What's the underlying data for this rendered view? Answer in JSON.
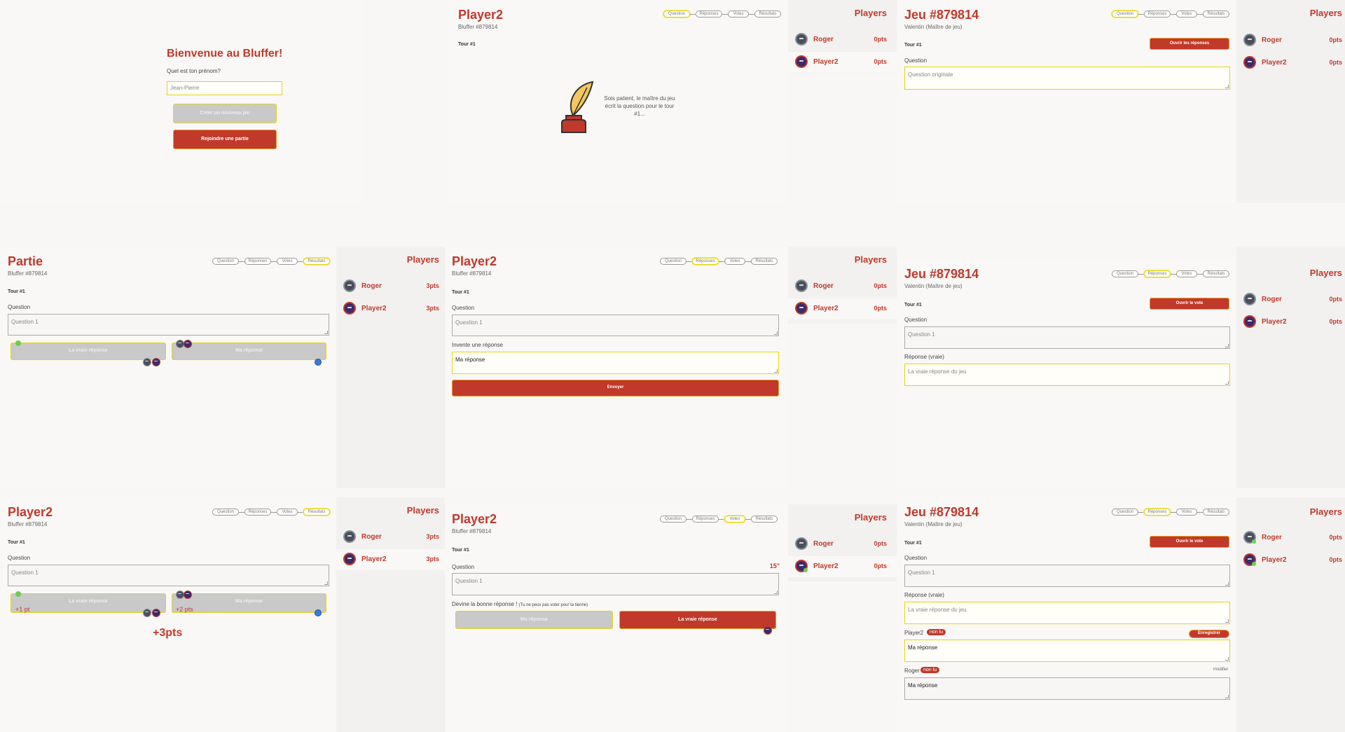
{
  "steps": [
    "Question",
    "Réponses",
    "Votes",
    "Résultats"
  ],
  "players_title": "Players",
  "welcome": {
    "title": "Bienvenue au Bluffer!",
    "prompt": "Quel est ton prénom?",
    "input_placeholder": "Jean-Pierre",
    "create_label": "Créer un nouveau jeu",
    "join_label": "Rejoindre une partie"
  },
  "p2_wait": {
    "title": "Player2",
    "subtitle": "Bluffer #879814",
    "tour": "Tour #1",
    "message": "Sois patient, le maître du jeu écrit la question pour le tour #1..."
  },
  "side_1": {
    "players": [
      {
        "name": "Roger",
        "pts": "0pts"
      },
      {
        "name": "Player2",
        "pts": "0pts"
      }
    ]
  },
  "master_q": {
    "title": "Jeu #879814",
    "subtitle": "Valentin (Maître de jeu)",
    "tour": "Tour #1",
    "button": "Ouvrir les réponses",
    "question_label": "Question",
    "question_placeholder": "Question originale"
  },
  "side_2": {
    "players": [
      {
        "name": "Roger",
        "pts": "0pts"
      },
      {
        "name": "Player2",
        "pts": "0pts"
      }
    ]
  },
  "partie": {
    "title": "Partie",
    "subtitle": "Bluffer #879814",
    "tour": "Tour #1",
    "question_label": "Question",
    "question_value": "Question 1",
    "answer_true": "La vraie réponse",
    "answer_mine": "Ma réponse"
  },
  "side_3": {
    "players": [
      {
        "name": "Roger",
        "pts": "3pts"
      },
      {
        "name": "Player2",
        "pts": "3pts"
      }
    ]
  },
  "p2_answer": {
    "title": "Player2",
    "subtitle": "Bluffer #879814",
    "tour": "Tour #1",
    "question_label": "Question",
    "question_value": "Question 1",
    "invent_label": "Invente une réponse",
    "answer_value": "Ma réponse",
    "send_label": "Envoyer"
  },
  "side_4": {
    "players": [
      {
        "name": "Roger",
        "pts": "0pts"
      },
      {
        "name": "Player2",
        "pts": "0pts"
      }
    ]
  },
  "master_a": {
    "title": "Jeu #879814",
    "subtitle": "Valentin (Maître de jeu)",
    "tour": "Tour #1",
    "button": "Ouvrir le vote",
    "question_label": "Question",
    "question_value": "Question 1",
    "answer_label": "Réponse (vraie)",
    "answer_placeholder": "La vraie réponse du jeu"
  },
  "side_5": {
    "players": [
      {
        "name": "Roger",
        "pts": "0pts"
      },
      {
        "name": "Player2",
        "pts": "0pts"
      }
    ]
  },
  "p2_result": {
    "title": "Player2",
    "subtitle": "Bluffer #879814",
    "tour": "Tour #1",
    "question_label": "Question",
    "question_value": "Question 1",
    "answer_true": "La vraie réponse",
    "answer_mine": "Ma réponse",
    "gain_true": "+1 pt",
    "gain_mine": "+2 pts",
    "total": "+3pts"
  },
  "side_6": {
    "players": [
      {
        "name": "Roger",
        "pts": "3pts"
      },
      {
        "name": "Player2",
        "pts": "3pts"
      }
    ]
  },
  "p2_vote": {
    "title": "Player2",
    "subtitle": "Bluffer #879814",
    "tour": "Tour #1",
    "timer": "15\"",
    "question_label": "Question",
    "question_value": "Question 1",
    "guess_label": "Devine la bonne réponse !",
    "guess_note": "(Tu ne peux pas voter pour ta tienne)",
    "opt_mine": "Ma réponse",
    "opt_true": "La vraie réponse"
  },
  "side_7": {
    "players": [
      {
        "name": "Roger",
        "pts": "0pts"
      },
      {
        "name": "Player2",
        "pts": "0pts"
      }
    ]
  },
  "master_v": {
    "title": "Jeu #879814",
    "subtitle": "Valentin (Maître de jeu)",
    "tour": "Tour #1",
    "button": "Ouvrir le vote",
    "question_label": "Question",
    "question_value": "Question 1",
    "answer_label": "Réponse (vraie)",
    "answer_placeholder": "La vraie réponse du jeu",
    "p2_name": "Player2",
    "unread": "non lu",
    "save_label": "Enregistrer",
    "p2_answer": "Ma réponse",
    "roger_name": "Roger",
    "modify_label": "modifier",
    "roger_answer": "Ma réponse"
  },
  "side_8": {
    "players": [
      {
        "name": "Roger",
        "pts": "0pts"
      },
      {
        "name": "Player2",
        "pts": "0pts"
      }
    ]
  }
}
